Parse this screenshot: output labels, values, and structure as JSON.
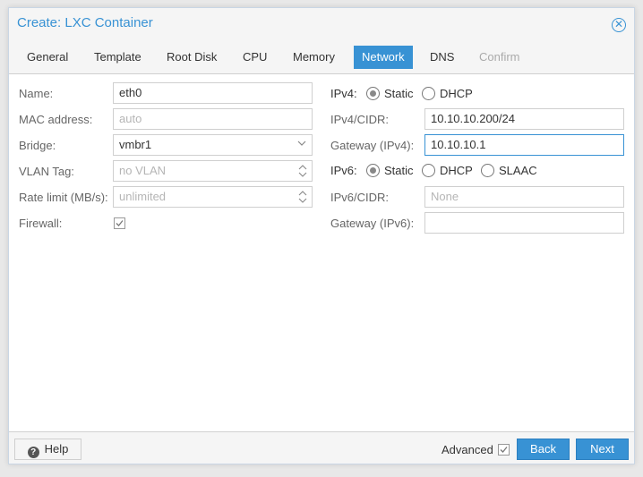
{
  "window": {
    "title": "Create: LXC Container"
  },
  "tabs": [
    {
      "label": "General"
    },
    {
      "label": "Template"
    },
    {
      "label": "Root Disk"
    },
    {
      "label": "CPU"
    },
    {
      "label": "Memory"
    },
    {
      "label": "Network"
    },
    {
      "label": "DNS"
    },
    {
      "label": "Confirm"
    }
  ],
  "active_tab": "Network",
  "left": {
    "name": {
      "label": "Name:",
      "value": "eth0"
    },
    "mac": {
      "label": "MAC address:",
      "placeholder": "auto"
    },
    "bridge": {
      "label": "Bridge:",
      "value": "vmbr1"
    },
    "vlan": {
      "label": "VLAN Tag:",
      "placeholder": "no VLAN"
    },
    "rate": {
      "label": "Rate limit (MB/s):",
      "placeholder": "unlimited"
    },
    "firewall": {
      "label": "Firewall:",
      "checked": true
    }
  },
  "right": {
    "ipv4": {
      "label": "IPv4:",
      "options": [
        "Static",
        "DHCP"
      ],
      "selected": "Static"
    },
    "ipv4_cidr": {
      "label": "IPv4/CIDR:",
      "value": "10.10.10.200/24"
    },
    "gateway4": {
      "label": "Gateway (IPv4):",
      "value": "10.10.10.1"
    },
    "ipv6": {
      "label": "IPv6:",
      "options": [
        "Static",
        "DHCP",
        "SLAAC"
      ],
      "selected": "Static"
    },
    "ipv6_cidr": {
      "label": "IPv6/CIDR:",
      "placeholder": "None"
    },
    "gateway6": {
      "label": "Gateway (IPv6):",
      "value": ""
    }
  },
  "footer": {
    "help_label": "Help",
    "advanced_label": "Advanced",
    "advanced_checked": true,
    "back_label": "Back",
    "next_label": "Next"
  },
  "colors": {
    "accent": "#3892d4",
    "panel_bg": "#f5f5f5",
    "disabled_text": "#aaaaaa"
  }
}
